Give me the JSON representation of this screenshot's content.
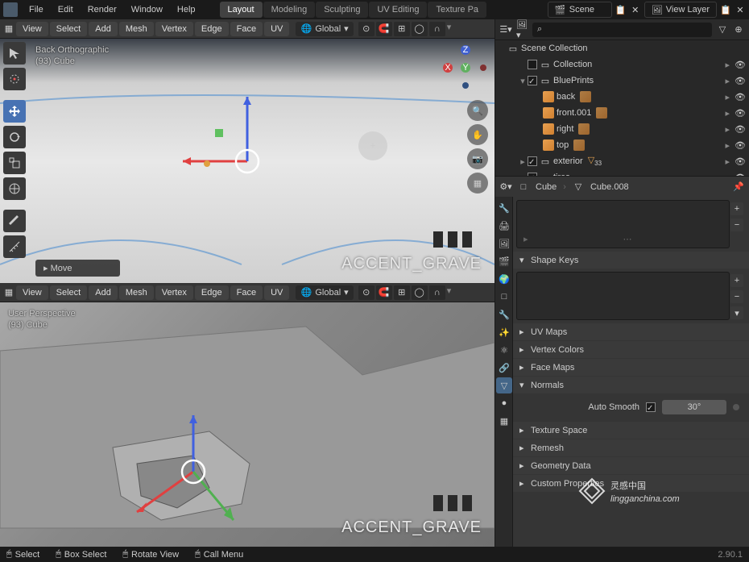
{
  "menus": [
    "File",
    "Edit",
    "Render",
    "Window",
    "Help"
  ],
  "workspaces": [
    {
      "label": "Layout",
      "active": true
    },
    {
      "label": "Modeling",
      "active": false
    },
    {
      "label": "Sculpting",
      "active": false
    },
    {
      "label": "UV Editing",
      "active": false
    },
    {
      "label": "Texture Pa",
      "active": false
    }
  ],
  "scene_selector": {
    "label": "Scene"
  },
  "layer_selector": {
    "label": "View Layer"
  },
  "view_header": {
    "menus": [
      "View",
      "Select",
      "Add",
      "Mesh",
      "Vertex",
      "Edge",
      "Face",
      "UV"
    ],
    "orientation": "Global"
  },
  "viewport1": {
    "info_line1": "Back Orthographic",
    "info_line2": "(93) Cube",
    "watermark": "ACCENT_GRAVE",
    "operator": "Move"
  },
  "viewport2": {
    "info_line1": "User Perspective",
    "info_line2": "(93) Cube",
    "watermark": "ACCENT_GRAVE"
  },
  "outliner": {
    "root": "Scene Collection",
    "items": [
      {
        "indent": 1,
        "expand": "",
        "chk": false,
        "icon": "collection",
        "label": "Collection"
      },
      {
        "indent": 1,
        "expand": "▾",
        "chk": true,
        "icon": "collection",
        "label": "BluePrints"
      },
      {
        "indent": 2,
        "expand": "",
        "chk": false,
        "icon": "image",
        "label": "back"
      },
      {
        "indent": 2,
        "expand": "",
        "chk": false,
        "icon": "image",
        "label": "front.001"
      },
      {
        "indent": 2,
        "expand": "",
        "chk": false,
        "icon": "image",
        "label": "right"
      },
      {
        "indent": 2,
        "expand": "",
        "chk": false,
        "icon": "image",
        "label": "top"
      },
      {
        "indent": 1,
        "expand": "▸",
        "chk": true,
        "icon": "collection",
        "label": "exterior"
      },
      {
        "indent": 1,
        "expand": "▸",
        "chk": true,
        "icon": "collection",
        "label": "tires"
      }
    ]
  },
  "props_hdr": {
    "object": "Cube",
    "data": "Cube.008"
  },
  "panels": {
    "shape_keys": "Shape Keys",
    "uv_maps": "UV Maps",
    "vertex_colors": "Vertex Colors",
    "face_maps": "Face Maps",
    "normals": "Normals",
    "auto_smooth": "Auto Smooth",
    "angle": "30°",
    "texture_space": "Texture Space",
    "remesh": "Remesh",
    "geometry_data": "Geometry Data",
    "custom_props": "Custom Properties"
  },
  "status": {
    "select": "Select",
    "box": "Box Select",
    "rotate": "Rotate View",
    "menu": "Call Menu",
    "version": "2.90.1"
  },
  "site_wm": {
    "cn": "灵感中国",
    "en": "lingganchina.com"
  }
}
